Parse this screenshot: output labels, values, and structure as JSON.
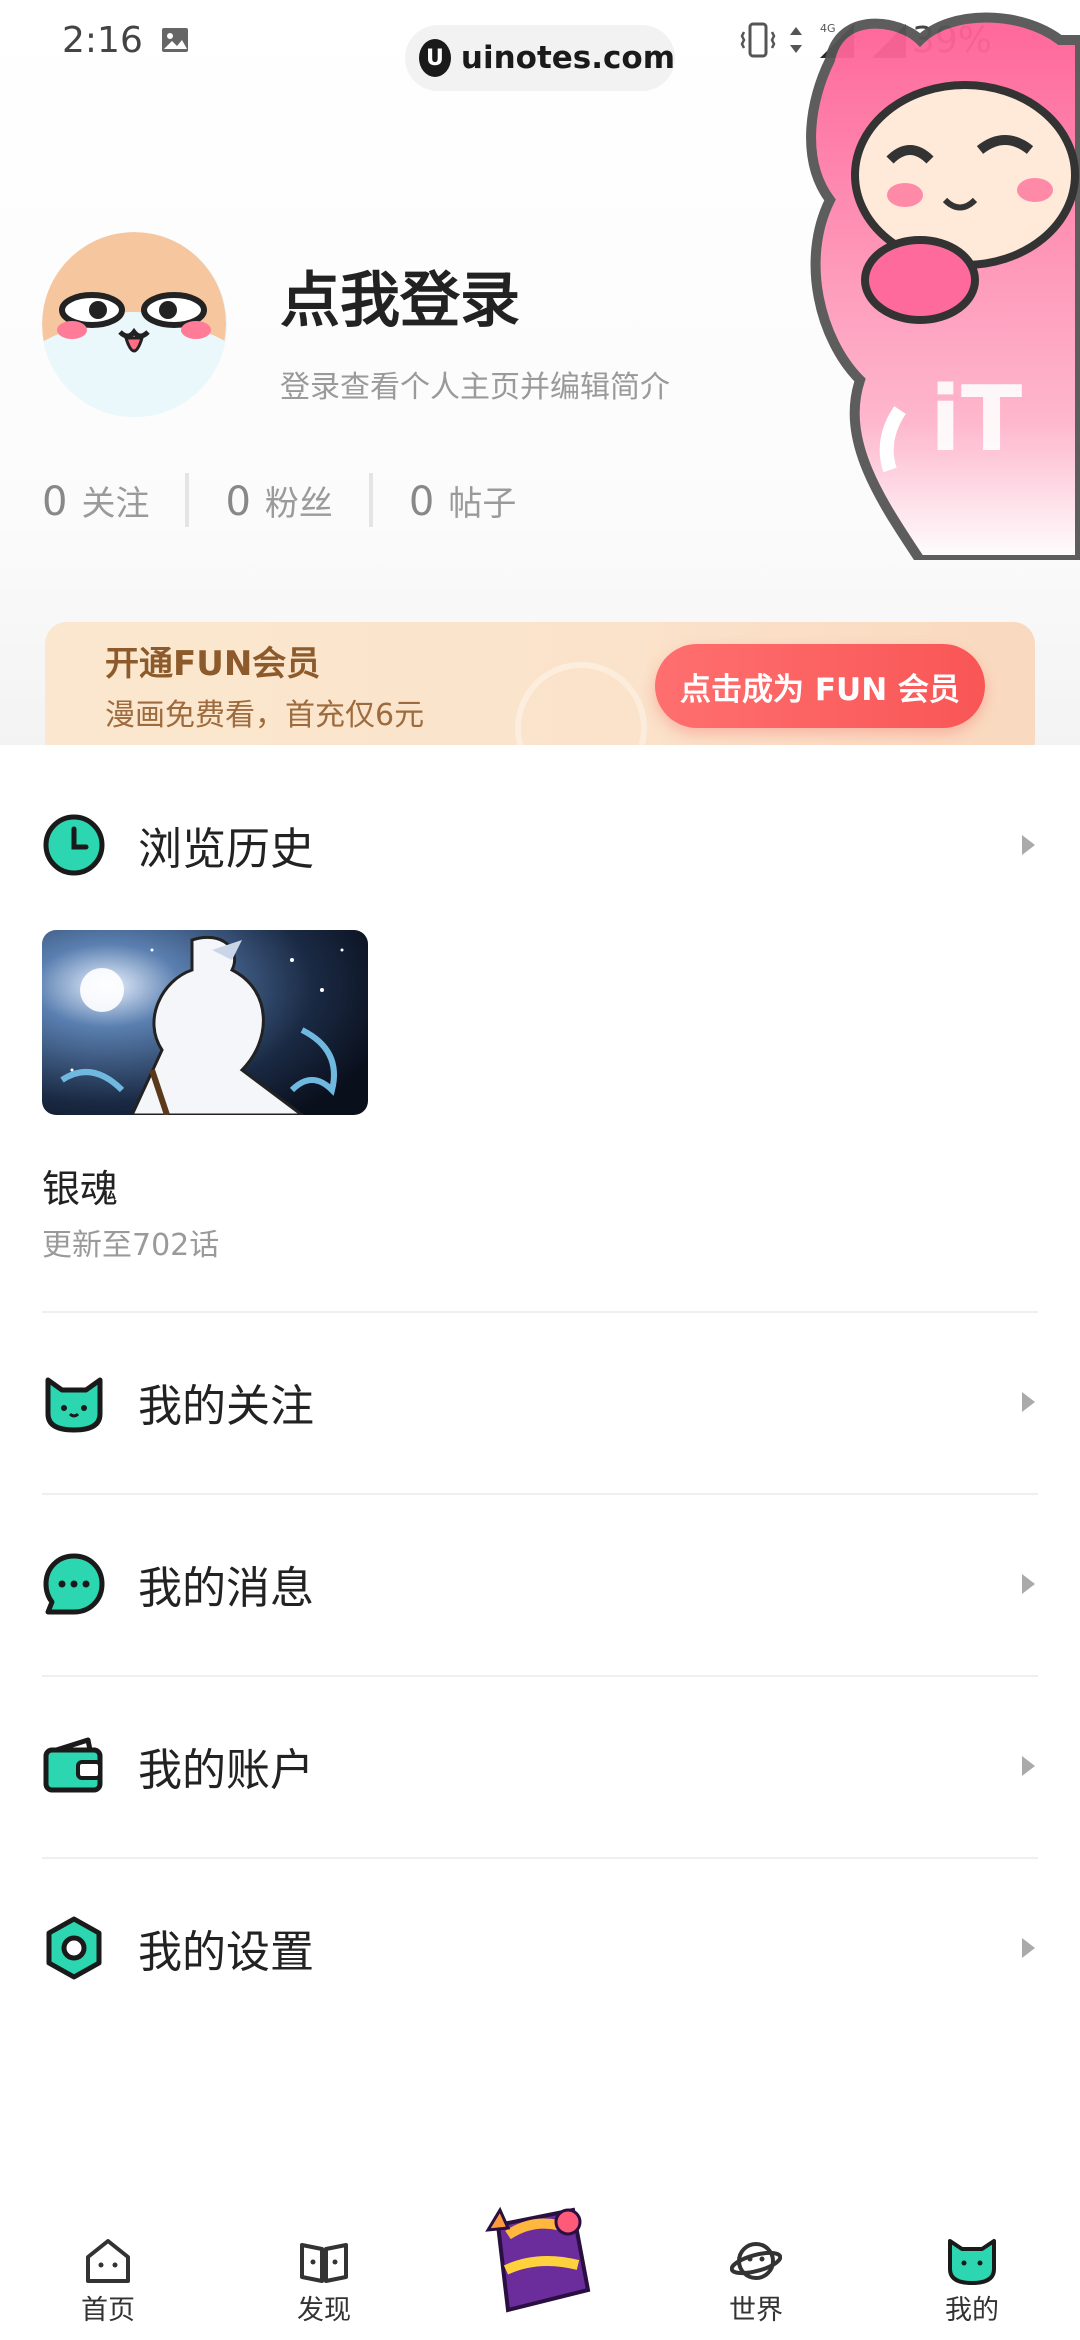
{
  "status_bar": {
    "time": "2:16",
    "url": "uinotes.com",
    "battery": "39%",
    "network": "4G"
  },
  "profile": {
    "login_title": "点我登录",
    "login_subtitle": "登录查看个人主页并编辑简介",
    "stats": [
      {
        "num": "0",
        "label": "关注"
      },
      {
        "num": "0",
        "label": "粉丝"
      },
      {
        "num": "0",
        "label": "帖子"
      }
    ]
  },
  "vip_banner": {
    "title": "开通FUN会员",
    "subtitle": "漫画免费看，首充仅6元",
    "button": "点击成为 FUN 会员"
  },
  "history": {
    "label": "浏览历史",
    "comic_title": "银魂",
    "comic_update": "更新至702话"
  },
  "menu": {
    "follow": "我的关注",
    "messages": "我的消息",
    "account": "我的账户",
    "settings": "我的设置"
  },
  "nav": {
    "home": "首页",
    "discover": "发现",
    "world": "世界",
    "mine": "我的"
  },
  "colors": {
    "accent_teal": "#2bd6b1",
    "vip_red": "#f95656",
    "mascot_pink": "#ff5f95"
  }
}
